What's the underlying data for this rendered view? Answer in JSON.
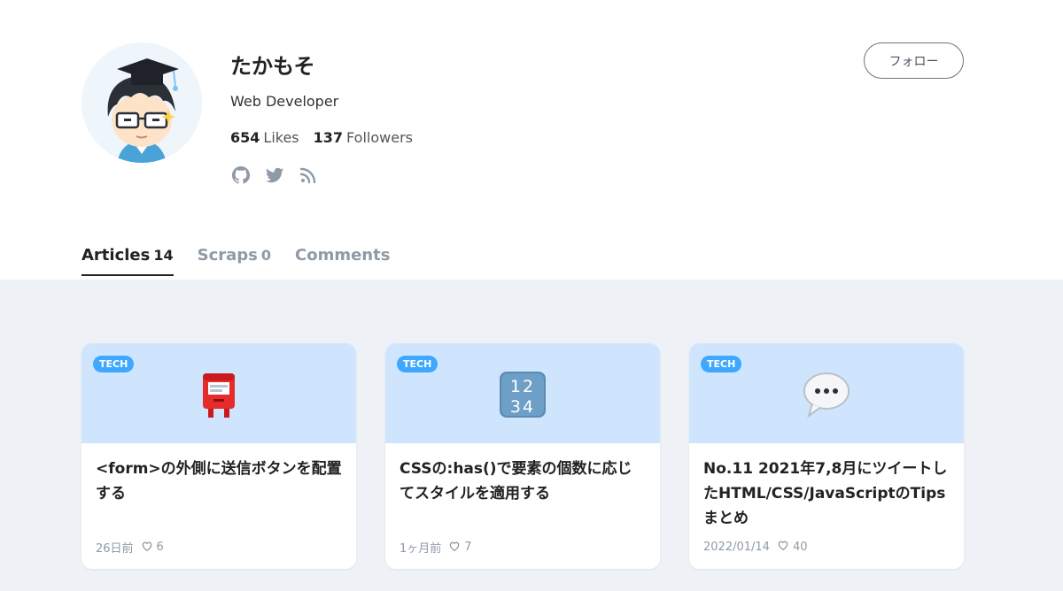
{
  "profile": {
    "name": "たかもそ",
    "bio": "Web Developer",
    "likes_count": "654",
    "likes_label": "Likes",
    "followers_count": "137",
    "followers_label": "Followers",
    "follow_label": "フォロー"
  },
  "tabs": [
    {
      "label": "Articles",
      "count": "14"
    },
    {
      "label": "Scraps",
      "count": "0"
    },
    {
      "label": "Comments",
      "count": ""
    }
  ],
  "cards": [
    {
      "badge": "TECH",
      "emoji": "postbox-icon",
      "title": "<form>の外側に送信ボタンを配置する",
      "date": "26日前",
      "likes": "6"
    },
    {
      "badge": "TECH",
      "emoji": "input-numbers-icon",
      "title": "CSSの:has()で要素の個数に応じてスタイルを適用する",
      "date": "1ヶ月前",
      "likes": "7"
    },
    {
      "badge": "TECH",
      "emoji": "speech-balloon-icon",
      "title": "No.11 2021年7,8月にツイートしたHTML/CSS/JavaScriptのTipsまとめ",
      "date": "2022/01/14",
      "likes": "40"
    }
  ],
  "colors": {
    "accent": "#3ea8ff",
    "card_top": "#cfe5fe",
    "main_bg": "#eef2f7",
    "muted": "#8f9aa6"
  }
}
